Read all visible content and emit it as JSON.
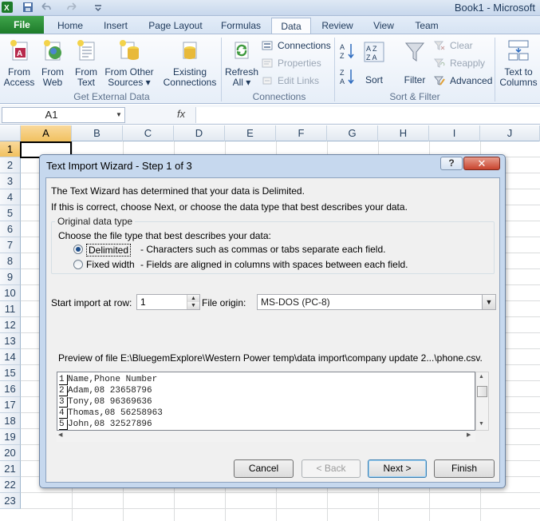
{
  "window": {
    "title": "Book1 - Microsoft"
  },
  "tabs": [
    {
      "label": "File"
    },
    {
      "label": "Home"
    },
    {
      "label": "Insert"
    },
    {
      "label": "Page Layout"
    },
    {
      "label": "Formulas"
    },
    {
      "label": "Data"
    },
    {
      "label": "Review"
    },
    {
      "label": "View"
    },
    {
      "label": "Team"
    }
  ],
  "ribbon": {
    "get_external": {
      "buttons": [
        {
          "label1": "From",
          "label2": "Access",
          "icon": "access-icon"
        },
        {
          "label1": "From",
          "label2": "Web",
          "icon": "web-icon"
        },
        {
          "label1": "From",
          "label2": "Text",
          "icon": "text-file-icon"
        },
        {
          "label1": "From Other",
          "label2": "Sources ▾",
          "icon": "database-icon"
        },
        {
          "label1": "Existing",
          "label2": "Connections",
          "icon": "connections-icon"
        }
      ],
      "group_label": "Get External Data"
    },
    "connections": {
      "refresh1": "Refresh",
      "refresh2": "All ▾",
      "connections": "Connections",
      "properties": "Properties",
      "edit_links": "Edit Links",
      "group_label": "Connections"
    },
    "sort_filter": {
      "sort": "Sort",
      "filter": "Filter",
      "clear": "Clear",
      "reapply": "Reapply",
      "advanced": "Advanced",
      "group_label": "Sort & Filter"
    },
    "text_to_columns": {
      "label1": "Text to",
      "label2": "Columns"
    }
  },
  "formula_bar": {
    "name_box": "A1",
    "fx": "fx",
    "value": ""
  },
  "sheet": {
    "columns": [
      "A",
      "B",
      "C",
      "D",
      "E",
      "F",
      "G",
      "H",
      "I",
      "J"
    ],
    "rows": [
      "1",
      "2",
      "3",
      "4",
      "5",
      "6",
      "7",
      "8",
      "9",
      "10",
      "11",
      "12",
      "13",
      "14",
      "15",
      "16",
      "17",
      "18",
      "19",
      "20",
      "21",
      "22",
      "23"
    ],
    "active_cell": "A1"
  },
  "dialog": {
    "title": "Text Import Wizard - Step 1 of 3",
    "help": "?",
    "close": "✕",
    "line1": "The Text Wizard has determined that your data is Delimited.",
    "line2": "If this is correct, choose Next, or choose the data type that best describes your data.",
    "group_title": "Original data type",
    "choose": "Choose the file type that best describes your data:",
    "delimited": {
      "label": "Delimited",
      "desc": "- Characters such as commas or tabs separate each field.",
      "selected": true
    },
    "fixed": {
      "label": "Fixed width",
      "desc": "- Fields are aligned in columns with spaces between each field.",
      "selected": false
    },
    "start_row_label": "Start import at row:",
    "start_row": "1",
    "origin_label": "File origin:",
    "origin": "MS-DOS (PC-8)",
    "preview_label": "Preview of file E:\\BluegemExplore\\Western Power temp\\data import\\company update 2...\\phone.csv.",
    "preview": [
      {
        "n": "1",
        "text": "Name,Phone Number"
      },
      {
        "n": "2",
        "text": "Adam,08 23658796"
      },
      {
        "n": "3",
        "text": "Tony,08 96369636"
      },
      {
        "n": "4",
        "text": "Thomas,08 56258963"
      },
      {
        "n": "5",
        "text": "John,08 32527896"
      }
    ],
    "buttons": {
      "cancel": "Cancel",
      "back": "< Back",
      "next": "Next >",
      "finish": "Finish"
    }
  }
}
